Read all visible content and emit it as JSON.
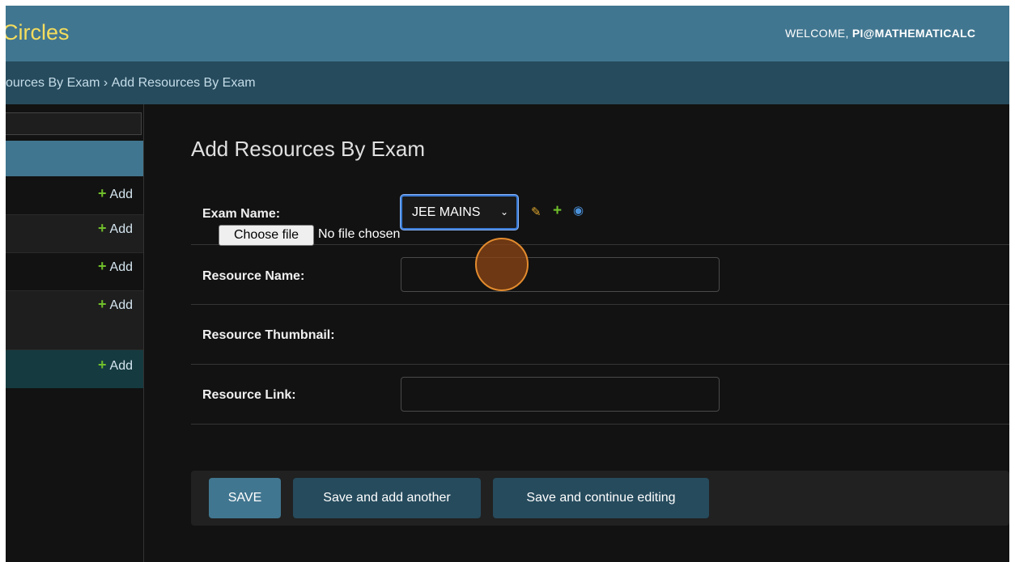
{
  "header": {
    "brand": "Circles",
    "welcome": "WELCOME, ",
    "user": "PI@MATHEMATICALC"
  },
  "breadcrumbs": {
    "parent": "sources By Exam",
    "separator": " › ",
    "current": "Add Resources By Exam"
  },
  "sidebar": {
    "add_label": "Add"
  },
  "form": {
    "title": "Add Resources By Exam",
    "fields": {
      "exam_name": {
        "label": "Exam Name:",
        "value": "JEE MAINS"
      },
      "resource_name": {
        "label": "Resource Name:",
        "value": ""
      },
      "resource_thumbnail": {
        "label": "Resource Thumbnail:",
        "button": "Choose file",
        "status": "No file chosen"
      },
      "resource_link": {
        "label": "Resource Link:",
        "value": ""
      }
    },
    "related_icons": [
      "pencil-icon",
      "plus-icon",
      "eye-icon"
    ]
  },
  "buttons": {
    "save": "SAVE",
    "save_add": "Save and add another",
    "save_continue": "Save and continue editing"
  },
  "colors": {
    "header_bg": "#417690",
    "breadcrumb_bg": "#264b5d",
    "brand": "#f5dd5d",
    "add_plus": "#70bf2b",
    "focus": "#3a7bd5"
  }
}
